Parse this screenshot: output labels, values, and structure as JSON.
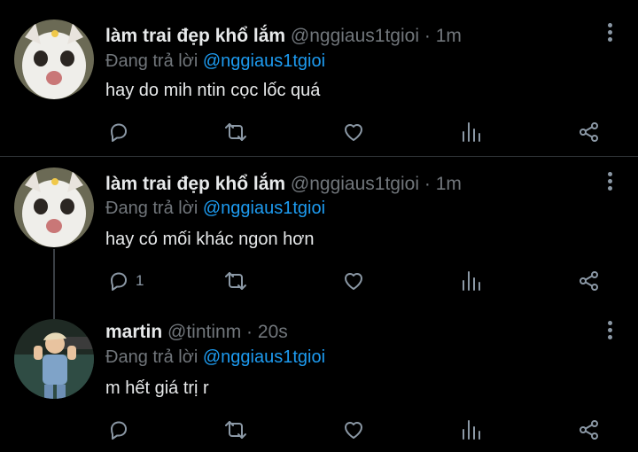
{
  "tweets": [
    {
      "name": "làm trai đẹp khổ lắm",
      "handle": "@nggiaus1tgioi",
      "separator": "·",
      "time": "1m",
      "reply_prefix": "Đang trả lời",
      "reply_to": "@nggiaus1tgioi",
      "text": "hay do mih ntin cọc lốc quá",
      "reply_count": "",
      "avatar_icon": "cat-avatar"
    },
    {
      "name": "làm trai đẹp khổ lắm",
      "handle": "@nggiaus1tgioi",
      "separator": "·",
      "time": "1m",
      "reply_prefix": "Đang trả lời",
      "reply_to": "@nggiaus1tgioi",
      "text": "hay có mối khác ngon hơn",
      "reply_count": "1",
      "avatar_icon": "cat-avatar"
    },
    {
      "name": "martin",
      "handle": "@tintinm",
      "separator": "·",
      "time": "20s",
      "reply_prefix": "Đang trả lời",
      "reply_to": "@nggiaus1tgioi",
      "text": "m hết giá trị r",
      "reply_count": "",
      "avatar_icon": "person-avatar"
    }
  ],
  "icons": [
    "reply-icon",
    "retweet-icon",
    "like-icon",
    "analytics-icon",
    "share-icon",
    "more-icon"
  ],
  "colors": {
    "background": "#000000",
    "link": "#1d9bf0",
    "muted": "#71767b",
    "text": "#e7e9ea"
  }
}
